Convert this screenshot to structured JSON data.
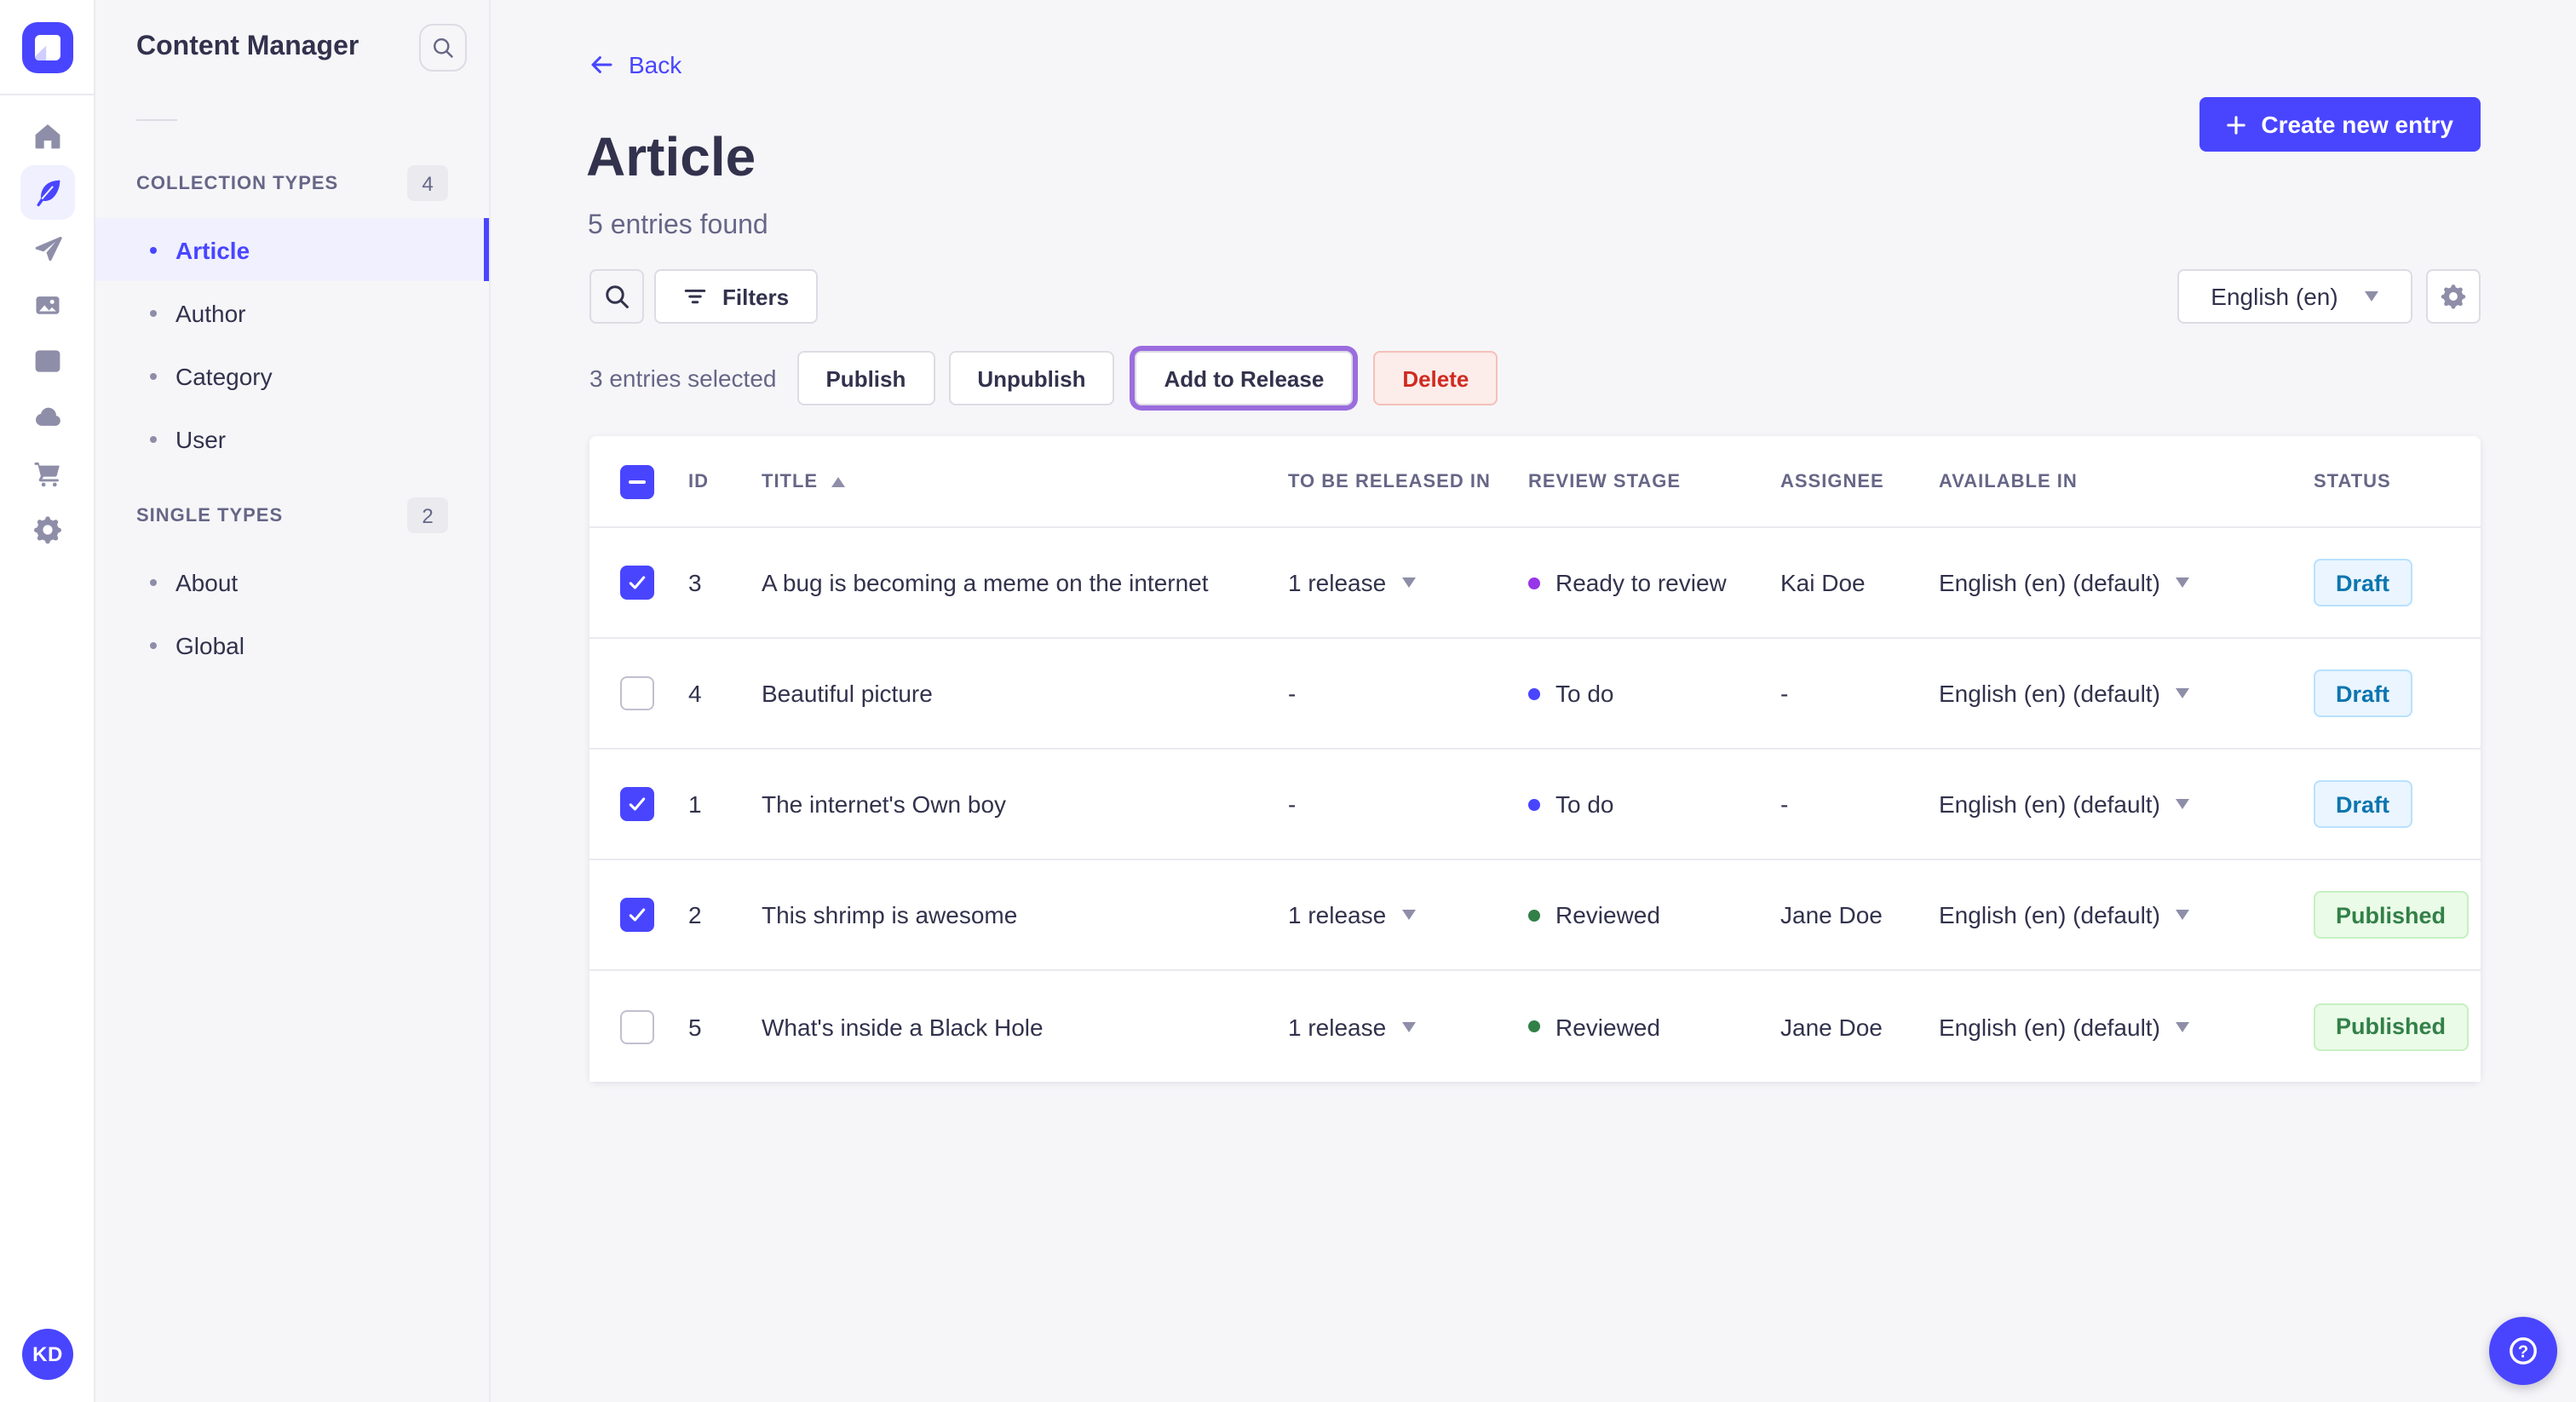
{
  "theme": {
    "primary": "#4945ff",
    "text": "#32324d",
    "muted": "#666687",
    "border": "#dcdce4",
    "line": "#eaeaef",
    "background": "#f6f6f9",
    "active_item_bg": "#f0f0ff",
    "release_focus_ring": "#9b6dde",
    "danger": {
      "bg": "#fcecea",
      "border": "#f5c0b8",
      "text": "#d02b20"
    }
  },
  "rail": {
    "avatar_initials": "KD",
    "items": [
      {
        "icon": "home"
      },
      {
        "icon": "content-manager",
        "active": true
      },
      {
        "icon": "releases"
      },
      {
        "icon": "media-library"
      },
      {
        "icon": "content-type-builder"
      },
      {
        "icon": "deploy"
      },
      {
        "icon": "marketplace"
      },
      {
        "icon": "settings"
      }
    ]
  },
  "subnav": {
    "title": "Content Manager",
    "sections": [
      {
        "label": "COLLECTION TYPES",
        "count": "4",
        "items": [
          {
            "label": "Article",
            "active": true
          },
          {
            "label": "Author"
          },
          {
            "label": "Category"
          },
          {
            "label": "User"
          }
        ]
      },
      {
        "label": "SINGLE TYPES",
        "count": "2",
        "items": [
          {
            "label": "About"
          },
          {
            "label": "Global"
          }
        ]
      }
    ]
  },
  "header": {
    "back_label": "Back",
    "title": "Article",
    "subtitle": "5 entries found",
    "create_label": "Create new entry"
  },
  "toolbar": {
    "filters_label": "Filters",
    "locale_value": "English (en)"
  },
  "selection": {
    "summary": "3 entries selected",
    "publish_label": "Publish",
    "unpublish_label": "Unpublish",
    "add_to_release_label": "Add to Release",
    "delete_label": "Delete"
  },
  "table": {
    "select_all_state": "indeterminate",
    "columns": {
      "id": "ID",
      "title": "TITLE",
      "release": "TO BE RELEASED IN",
      "stage": "REVIEW STAGE",
      "assignee": "ASSIGNEE",
      "available": "AVAILABLE IN",
      "status": "STATUS"
    },
    "sort": {
      "column": "TITLE",
      "direction": "asc"
    },
    "status_colors": {
      "Draft": {
        "bg": "#eaf5ff",
        "border": "#b8e1ff",
        "text": "#0c75af"
      },
      "Published": {
        "bg": "#eafbe7",
        "border": "#c6f0c2",
        "text": "#328048"
      }
    },
    "rows": [
      {
        "checked": true,
        "id": "3",
        "title": "A bug is becoming a meme on the internet",
        "release": "1 release",
        "stage": "Ready to review",
        "stage_color": "#9736e8",
        "assignee": "Kai Doe",
        "locale": "English (en) (default)",
        "status": "Draft"
      },
      {
        "checked": false,
        "id": "4",
        "title": "Beautiful picture",
        "release": "-",
        "stage": "To do",
        "stage_color": "#4945ff",
        "assignee": "-",
        "locale": "English (en) (default)",
        "status": "Draft"
      },
      {
        "checked": true,
        "id": "1",
        "title": "The internet's Own boy",
        "release": "-",
        "stage": "To do",
        "stage_color": "#4945ff",
        "assignee": "-",
        "locale": "English (en) (default)",
        "status": "Draft"
      },
      {
        "checked": true,
        "id": "2",
        "title": "This shrimp is awesome",
        "release": "1 release",
        "stage": "Reviewed",
        "stage_color": "#328048",
        "assignee": "Jane Doe",
        "locale": "English (en) (default)",
        "status": "Published"
      },
      {
        "checked": false,
        "id": "5",
        "title": "What's inside a Black Hole",
        "release": "1 release",
        "stage": "Reviewed",
        "stage_color": "#328048",
        "assignee": "Jane Doe",
        "locale": "English (en) (default)",
        "status": "Published"
      }
    ]
  },
  "help": {
    "tooltip": "Help"
  }
}
